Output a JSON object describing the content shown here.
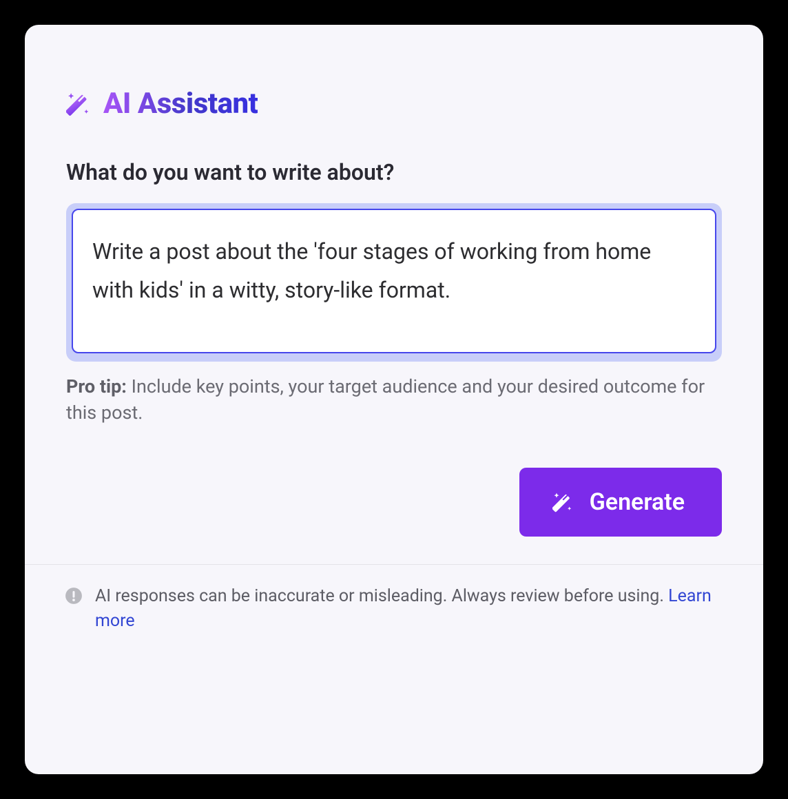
{
  "header": {
    "title": "AI Assistant"
  },
  "prompt": {
    "label": "What do you want to write about?",
    "value": "Write a post about the 'four stages of working from home with kids' in a witty, story-like format."
  },
  "pro_tip": {
    "label": "Pro tip:",
    "text": " Include key points, your target audience and your desired outcome for this post."
  },
  "button": {
    "generate": "Generate"
  },
  "footer": {
    "disclaimer": "AI responses can be inaccurate or misleading. Always review before using. ",
    "learn_more": "Learn more"
  }
}
